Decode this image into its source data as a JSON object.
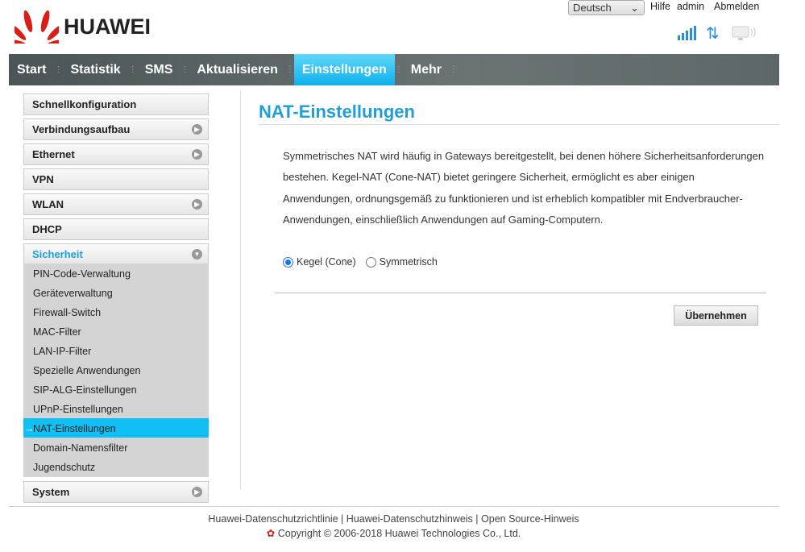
{
  "header": {
    "brand": "HUAWEI",
    "language": "Deutsch",
    "help": "Hilfe",
    "user": "admin",
    "logout": "Abmelden"
  },
  "nav": [
    "Start",
    "Statistik",
    "SMS",
    "Aktualisieren",
    "Einstellungen",
    "Mehr"
  ],
  "sidebar": {
    "items": [
      "Schnellkonfiguration",
      "Verbindungsaufbau",
      "Ethernet",
      "VPN",
      "WLAN",
      "DHCP",
      "Sicherheit"
    ],
    "sub": [
      "PIN-Code-Verwaltung",
      "Geräteverwaltung",
      "Firewall-Switch",
      "MAC-Filter",
      "LAN-IP-Filter",
      "Spezielle Anwendungen",
      "SIP-ALG-Einstellungen",
      "UPnP-Einstellungen",
      "NAT-Einstellungen",
      "Domain-Namensfilter",
      "Jugendschutz"
    ],
    "system": "System"
  },
  "main": {
    "title": "NAT-Einstellungen",
    "description": "Symmetrisches NAT wird häufig in Gateways bereitgestellt, bei denen höhere Sicherheitsanforderungen bestehen. Kegel-NAT (Cone-NAT) bietet geringere Sicherheit, ermöglicht es aber einigen Anwendungen, ordnungsgemäß zu funktionieren und ist erheblich kompatibler mit Endverbraucher-Anwendungen, einschließlich Anwendungen auf Gaming-Computern.",
    "option1": "Kegel (Cone)",
    "option2": "Symmetrisch",
    "apply": "Übernehmen"
  },
  "footer": {
    "links": [
      "Huawei-Datenschutzrichtlinie",
      "Huawei-Datenschutzhinweis",
      "Open Source-Hinweis"
    ],
    "copyright": "Copyright © 2006-2018 Huawei Technologies Co., Ltd."
  },
  "colors": {
    "accent": "#1f9fd6",
    "active": "#0fc0f5"
  }
}
